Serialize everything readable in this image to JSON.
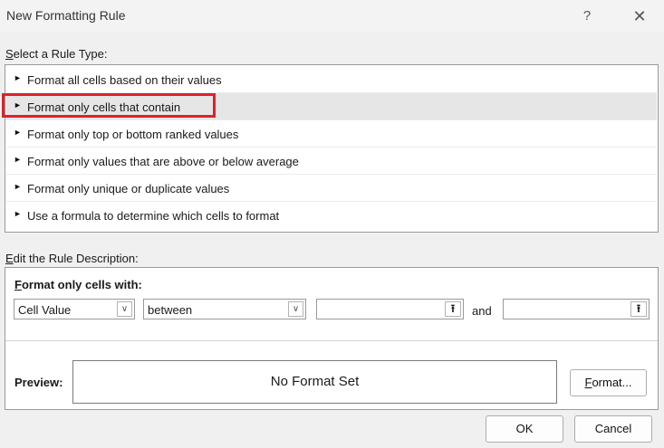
{
  "dialog": {
    "title": "New Formatting Rule",
    "help": "?",
    "close": "✕"
  },
  "rule_type": {
    "label_prefix": "S",
    "label_rest": "elect a Rule Type:",
    "bullet": "►",
    "items": [
      {
        "label": "Format all cells based on their values"
      },
      {
        "label": "Format only cells that contain"
      },
      {
        "label": "Format only top or bottom ranked values"
      },
      {
        "label": "Format only values that are above or below average"
      },
      {
        "label": "Format only unique or duplicate values"
      },
      {
        "label": "Use a formula to determine which cells to format"
      }
    ],
    "selected_index": 1,
    "highlight_color": "#e0202a"
  },
  "description": {
    "label_prefix": "E",
    "label_rest": "dit the Rule Description:",
    "format_title_prefix": "F",
    "format_title_rest": "ormat only cells with:",
    "condition_type": {
      "value": "Cell Value"
    },
    "operator": {
      "value": "between"
    },
    "value1": "",
    "value2": "",
    "and_label": "and",
    "dropdown_glyph": "∨",
    "refedit_glyph": "⭱",
    "preview_label": "Preview:",
    "preview_text": "No Format Set",
    "format_button_prefix": "F",
    "format_button_rest": "ormat..."
  },
  "buttons": {
    "ok": "OK",
    "cancel": "Cancel"
  }
}
